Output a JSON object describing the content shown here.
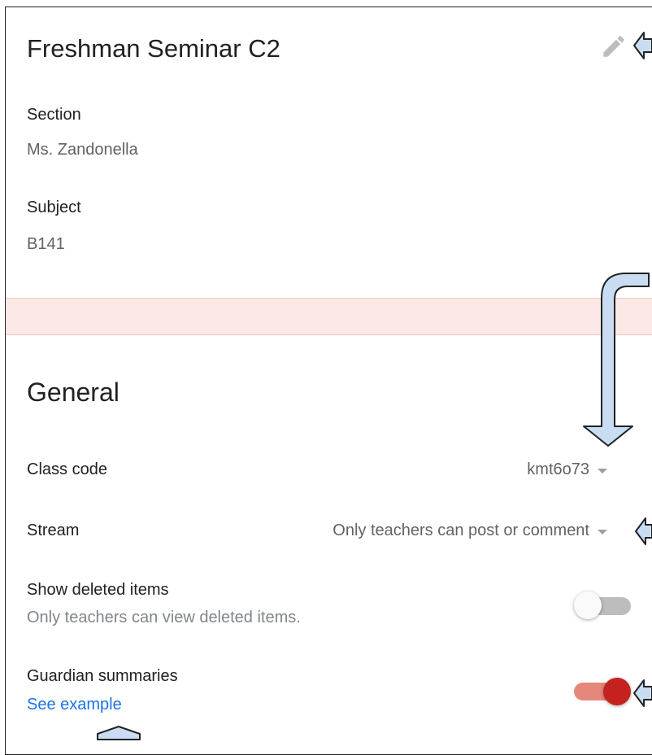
{
  "header": {
    "title": "Freshman Seminar C2",
    "edit_icon": "pencil-icon"
  },
  "details": {
    "section_label": "Section",
    "section_value": "Ms. Zandonella",
    "subject_label": "Subject",
    "subject_value": "B141"
  },
  "general": {
    "heading": "General",
    "class_code": {
      "label": "Class code",
      "value": "kmt6o73"
    },
    "stream": {
      "label": "Stream",
      "value": "Only teachers can post or comment"
    },
    "show_deleted": {
      "label": "Show deleted items",
      "description": "Only teachers can view deleted items.",
      "enabled": false
    },
    "guardian": {
      "label": "Guardian summaries",
      "link": "See example",
      "enabled": true
    }
  },
  "colors": {
    "accent_red": "#c5221f",
    "link_blue": "#1a73e8",
    "banner_pink": "#fce8e6",
    "arrow_fill": "#c9dcf2"
  }
}
